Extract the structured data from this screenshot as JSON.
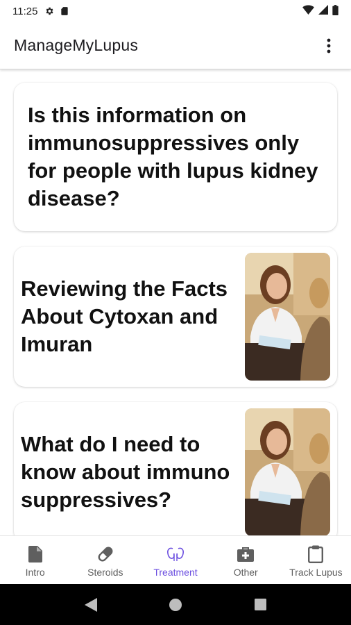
{
  "status_bar": {
    "time": "11:25"
  },
  "app_bar": {
    "title": "ManageMyLupus"
  },
  "cards": [
    {
      "text": "Is this information on immunosuppressives only for people with lupus kidney disease?"
    },
    {
      "text": "Reviewing the Facts About Cytoxan and Imuran",
      "image": "doctor-consultation-photo"
    },
    {
      "text": "What do I need to know about immuno suppressives?",
      "image": "doctor-consultation-photo"
    }
  ],
  "bottom_nav": {
    "active": "Treatment",
    "accent": "#6c4fe0",
    "items": [
      {
        "label": "Intro",
        "icon": "document-icon"
      },
      {
        "label": "Steroids",
        "icon": "pill-icon"
      },
      {
        "label": "Treatment",
        "icon": "kidneys-icon"
      },
      {
        "label": "Other",
        "icon": "medical-kit-icon"
      },
      {
        "label": "Track Lupus",
        "icon": "clipboard-icon"
      }
    ]
  }
}
